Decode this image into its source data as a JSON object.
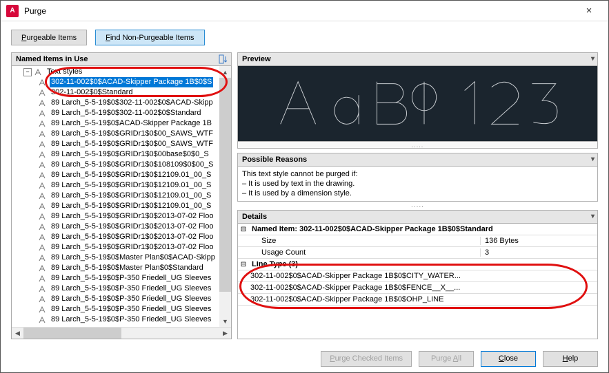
{
  "window": {
    "title": "Purge",
    "app_icon": "A",
    "close": "×"
  },
  "toolbar": {
    "purgeable": "Purgeable Items",
    "find_non": "Find Non-Purgeable Items"
  },
  "left": {
    "header": "Named Items in Use",
    "root": "Text styles",
    "selected": "302-11-002$0$ACAD-Skipper Package 1B$0$S",
    "items": [
      "302-11-002$0$Standard",
      "89 Larch_5-5-19$0$302-11-002$0$ACAD-Skipp",
      "89 Larch_5-5-19$0$302-11-002$0$Standard",
      "89 Larch_5-5-19$0$ACAD-Skipper Package 1B",
      "89 Larch_5-5-19$0$GRIDr1$0$00_SAWS_WTF",
      "89 Larch_5-5-19$0$GRIDr1$0$00_SAWS_WTF",
      "89 Larch_5-5-19$0$GRIDr1$0$00base$0$0_S",
      "89 Larch_5-5-19$0$GRIDr1$0$108109$0$00_S",
      "89 Larch_5-5-19$0$GRIDr1$0$12109.01_00_S",
      "89 Larch_5-5-19$0$GRIDr1$0$12109.01_00_S",
      "89 Larch_5-5-19$0$GRIDr1$0$12109.01_00_S",
      "89 Larch_5-5-19$0$GRIDr1$0$12109.01_00_S",
      "89 Larch_5-5-19$0$GRIDr1$0$2013-07-02 Floo",
      "89 Larch_5-5-19$0$GRIDr1$0$2013-07-02 Floo",
      "89 Larch_5-5-19$0$GRIDr1$0$2013-07-02 Floo",
      "89 Larch_5-5-19$0$GRIDr1$0$2013-07-02 Floo",
      "89 Larch_5-5-19$0$Master Plan$0$ACAD-Skipp",
      "89 Larch_5-5-19$0$Master Plan$0$Standard",
      "89 Larch_5-5-19$0$P-350 Friedell_UG Sleeves",
      "89 Larch_5-5-19$0$P-350 Friedell_UG Sleeves",
      "89 Larch_5-5-19$0$P-350 Friedell_UG Sleeves",
      "89 Larch_5-5-19$0$P-350 Friedell_UG Sleeves",
      "89 Larch_5-5-19$0$P-350 Friedell_UG Sleeves"
    ]
  },
  "preview": {
    "header": "Preview",
    "sample": "AaBb123"
  },
  "reasons": {
    "header": "Possible Reasons",
    "line1": "This text style cannot be purged if:",
    "line2": "– It is used by text in the drawing.",
    "line3": "– It is used by a dimension style."
  },
  "details": {
    "header": "Details",
    "named_item_label": "Named Item: 302-11-002$0$ACAD-Skipper Package 1B$0$Standard",
    "size_label": "Size",
    "size_value": "136 Bytes",
    "usage_label": "Usage Count",
    "usage_value": "3",
    "linetype_header": "Line Type (3)",
    "lt1": "302-11-002$0$ACAD-Skipper Package 1B$0$CITY_WATER...",
    "lt2": "302-11-002$0$ACAD-Skipper Package 1B$0$FENCE__X__...",
    "lt3": "302-11-002$0$ACAD-Skipper Package 1B$0$OHP_LINE"
  },
  "footer": {
    "purge_checked": "Purge Checked Items",
    "purge_all": "Purge All",
    "close": "Close",
    "help": "Help"
  },
  "dots": "....."
}
